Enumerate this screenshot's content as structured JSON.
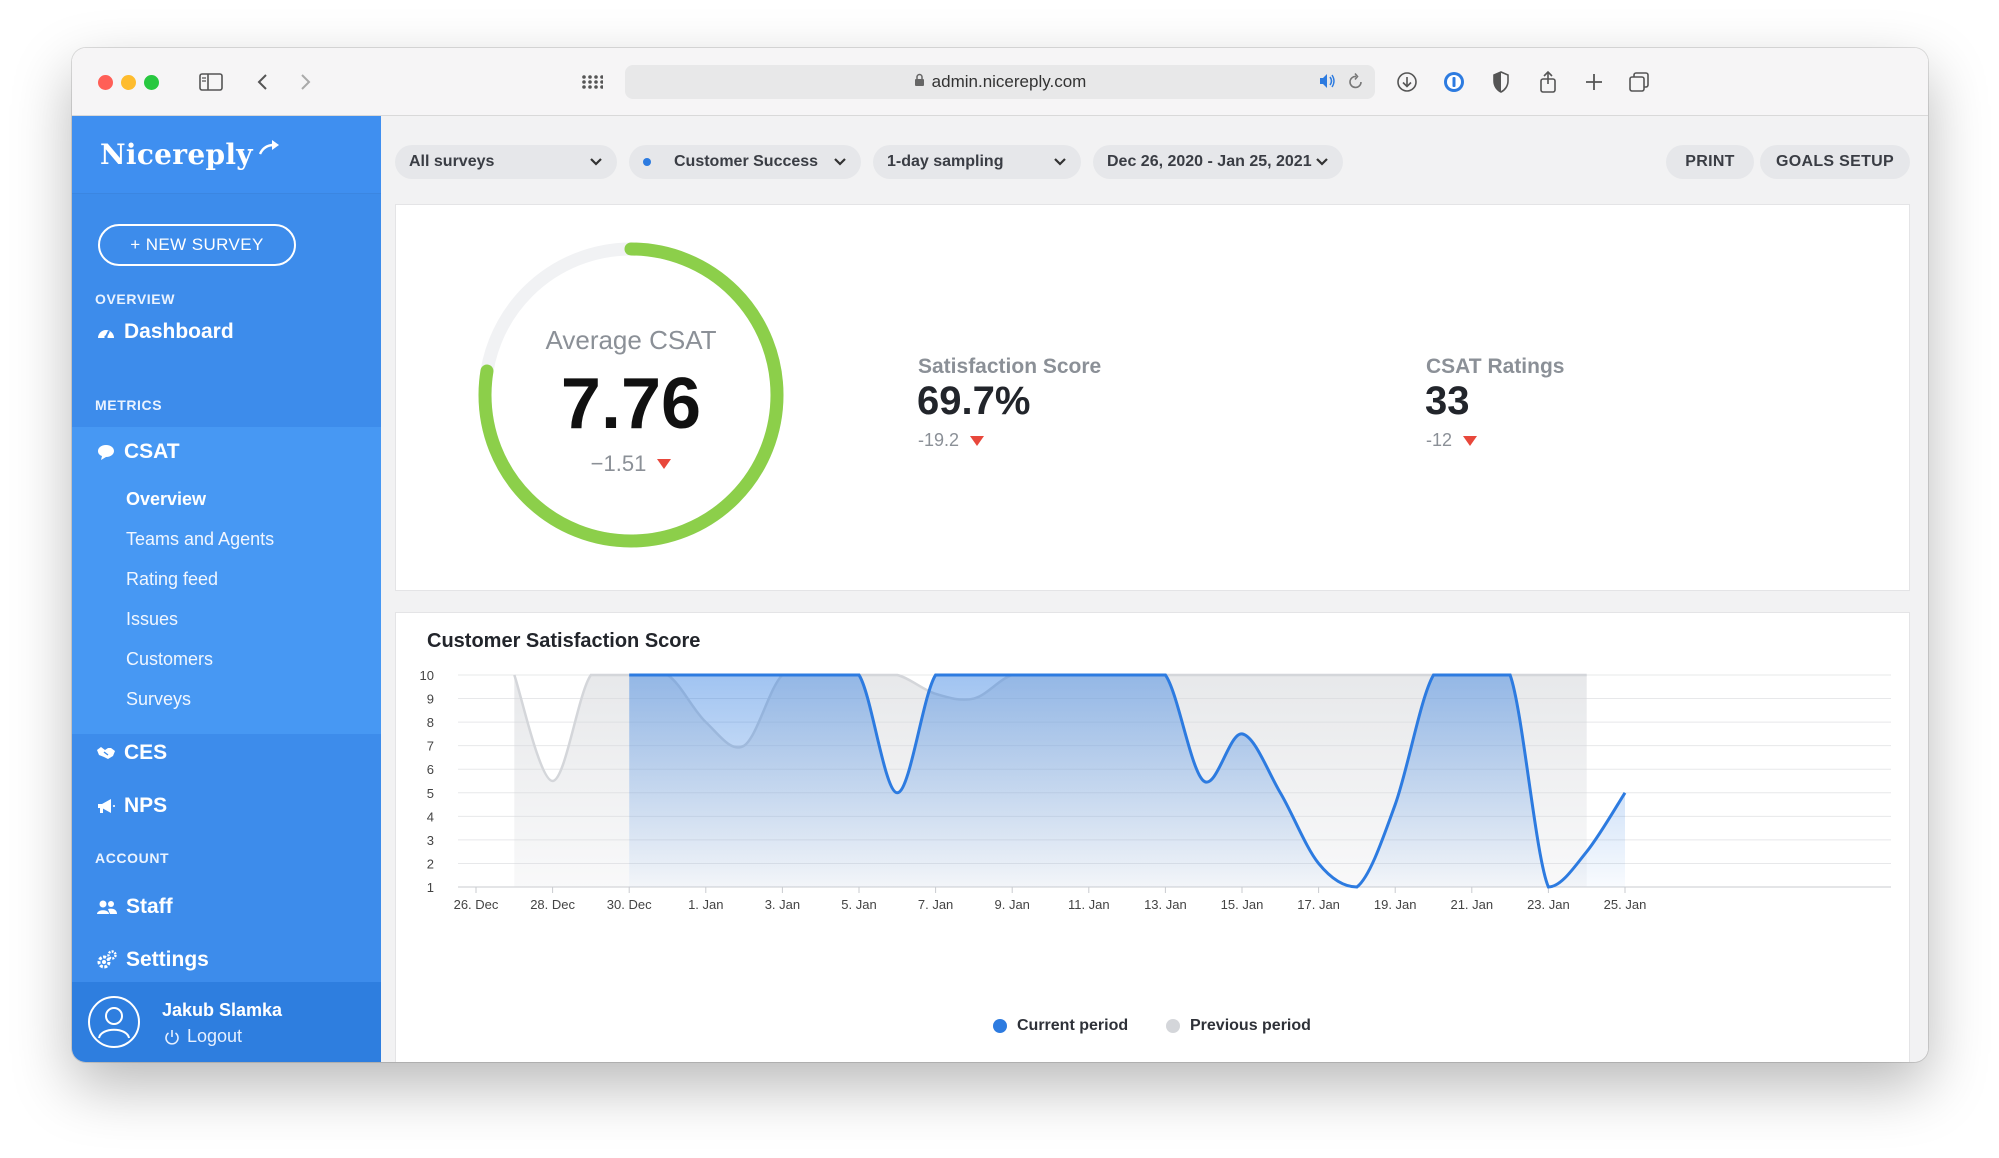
{
  "browser": {
    "url": "admin.nicereply.com"
  },
  "sidebar": {
    "brand": "Nicereply",
    "new_survey": "+ NEW SURVEY",
    "section_overview": "OVERVIEW",
    "dashboard": "Dashboard",
    "section_metrics": "METRICS",
    "csat": "CSAT",
    "csat_items": [
      "Overview",
      "Teams and Agents",
      "Rating feed",
      "Issues",
      "Customers",
      "Surveys"
    ],
    "ces": "CES",
    "nps": "NPS",
    "section_account": "ACCOUNT",
    "staff": "Staff",
    "settings": "Settings",
    "user_name": "Jakub Slamka",
    "logout": "Logout"
  },
  "filters": {
    "surveys": "All surveys",
    "team": "Customer Success",
    "sampling": "1-day sampling",
    "date_range": "Dec 26, 2020 - Jan 25, 2021",
    "print": "PRINT",
    "goals": "GOALS SETUP"
  },
  "summary": {
    "avg_label": "Average CSAT",
    "avg_value": "7.76",
    "avg_delta": "−1.51",
    "gauge_fraction": 0.776,
    "satisfaction_label": "Satisfaction Score",
    "satisfaction_value": "69.7%",
    "satisfaction_delta": "-19.2",
    "ratings_label": "CSAT Ratings",
    "ratings_value": "33",
    "ratings_delta": "-12"
  },
  "colors": {
    "brand_blue": "#3d8ceb",
    "current": "#2d7be0",
    "previous": "#d4d6da",
    "gauge": "#8ccf4a",
    "negative": "#e8473b"
  },
  "chart_data": {
    "type": "area",
    "title": "Customer Satisfaction Score",
    "x_ticks": [
      "26. Dec",
      "28. Dec",
      "30. Dec",
      "1. Jan",
      "3. Jan",
      "5. Jan",
      "7. Jan",
      "9. Jan",
      "11. Jan",
      "13. Jan",
      "15. Jan",
      "17. Jan",
      "19. Jan",
      "21. Jan",
      "23. Jan",
      "25. Jan"
    ],
    "y_ticks": [
      1,
      2,
      3,
      4,
      5,
      6,
      7,
      8,
      9,
      10
    ],
    "ylim": [
      1,
      10
    ],
    "grid": true,
    "legend_position": "bottom",
    "series": [
      {
        "name": "Current period",
        "x": [
          "30. Dec",
          "31. Dec",
          "1. Jan",
          "2. Jan",
          "3. Jan",
          "4. Jan",
          "5. Jan",
          "6. Jan",
          "7. Jan",
          "8. Jan",
          "9. Jan",
          "10. Jan",
          "11. Jan",
          "12. Jan",
          "13. Jan",
          "14. Jan",
          "15. Jan",
          "16. Jan",
          "17. Jan",
          "18. Jan",
          "19. Jan",
          "20. Jan",
          "21. Jan",
          "22. Jan",
          "23. Jan",
          "24. Jan",
          "25. Jan"
        ],
        "values": [
          10,
          10,
          10,
          10,
          10,
          10,
          10,
          5,
          10,
          10,
          10,
          10,
          10,
          10,
          10,
          5.5,
          7.5,
          5,
          2,
          1,
          4.5,
          10,
          10,
          10,
          1,
          2.5,
          5
        ]
      },
      {
        "name": "Previous period",
        "x": [
          "27. Dec",
          "28. Dec",
          "29. Dec",
          "30. Dec",
          "31. Dec",
          "1. Jan",
          "2. Jan",
          "3. Jan",
          "4. Jan",
          "5. Jan",
          "6. Jan",
          "7. Jan",
          "8. Jan",
          "9. Jan",
          "10. Jan",
          "11. Jan",
          "12. Jan",
          "13. Jan",
          "14. Jan",
          "15. Jan",
          "16. Jan",
          "17. Jan",
          "18. Jan",
          "19. Jan",
          "20. Jan",
          "21. Jan",
          "22. Jan",
          "23. Jan",
          "24. Jan"
        ],
        "values": [
          10,
          5.5,
          10,
          10,
          10,
          8,
          7,
          10,
          10,
          10,
          10,
          9.2,
          9,
          10,
          10,
          10,
          10,
          10,
          10,
          10,
          10,
          10,
          10,
          10,
          10,
          10,
          10,
          10,
          10
        ]
      }
    ]
  }
}
